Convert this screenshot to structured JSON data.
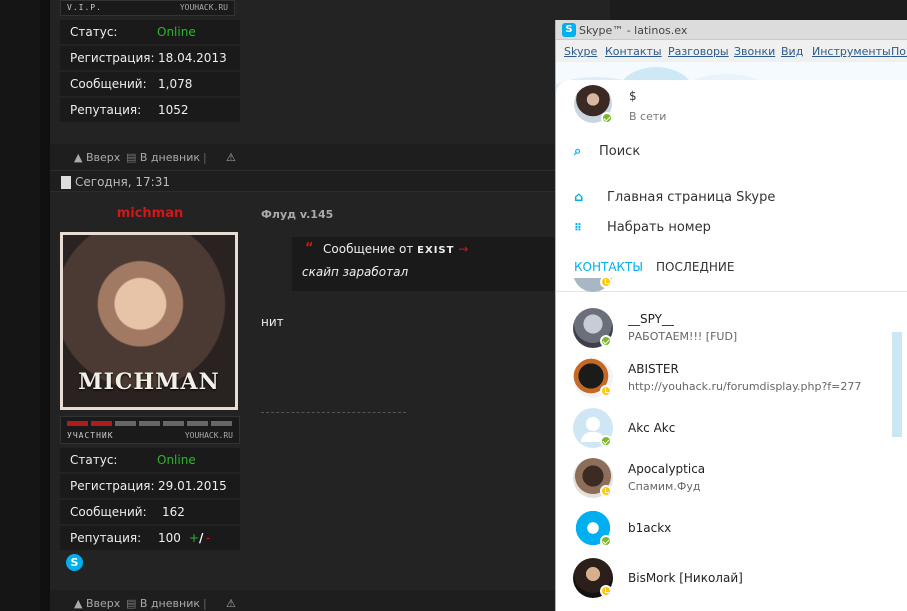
{
  "forum": {
    "post1": {
      "role": "V.I.P.",
      "site": "YOUHACK.RU",
      "stats": [
        {
          "label": "Статус:",
          "value": "Online"
        },
        {
          "label": "Регистрация:",
          "value": "18.04.2013"
        },
        {
          "label": "Сообщений:",
          "value": "1,078"
        },
        {
          "label": "Репутация:",
          "value": "1052"
        }
      ],
      "actions": {
        "up": "Вверх",
        "diary": "В дневник"
      }
    },
    "date": "Сегодня, 17:31",
    "post2": {
      "username": "michman",
      "avatar_caption": "MICHMAN",
      "role": "УЧАСТНИК",
      "site": "YOUHACK.RU",
      "rank_filled": 2,
      "rank_total": 7,
      "stats": [
        {
          "label": "Статус:",
          "value": "Online"
        },
        {
          "label": "Регистрация:",
          "value": "29.01.2015"
        },
        {
          "label": "Сообщений:",
          "value": "162"
        },
        {
          "label": "Репутация:",
          "value": "100"
        }
      ],
      "rep_plus": "+",
      "rep_sep": "/",
      "rep_minus": "-",
      "skype_icon": "S",
      "thread": "Флуд v.145",
      "quote_prefix": "Сообщение от",
      "quote_author": "EXIST",
      "quote_text": "скайп заработал",
      "post_text": "нит",
      "actions": {
        "up": "Вверх",
        "diary": "В дневник"
      }
    }
  },
  "skype": {
    "logo": "S",
    "title": "Skype™ - latinos.ex",
    "menu": [
      "Skype",
      "Контакты",
      "Разговоры",
      "Звонки",
      "Вид",
      "Инструменты",
      "Пом"
    ],
    "me": {
      "name": "$",
      "status": "В сети"
    },
    "search": "Поиск",
    "home": "Главная страница Skype",
    "dial": "Набрать номер",
    "tabs": {
      "contacts": "КОНТАКТЫ",
      "recent": "ПОСЛЕДНИЕ"
    },
    "contacts": [
      {
        "name": "__SPY__",
        "sub": "РАБОТАЕМ!!! [FUD]",
        "status": "online"
      },
      {
        "name": "ABISTER",
        "sub": "http://youhack.ru/forumdisplay.php?f=277",
        "status": "away"
      },
      {
        "name": "Akc Akc",
        "sub": "",
        "status": "online"
      },
      {
        "name": "Apocalyptica",
        "sub": "Спамим.Фуд",
        "status": "away"
      },
      {
        "name": "b1ackx",
        "sub": "",
        "status": "online"
      },
      {
        "name": "BisMork [Николай]",
        "sub": "",
        "status": "away"
      }
    ]
  }
}
